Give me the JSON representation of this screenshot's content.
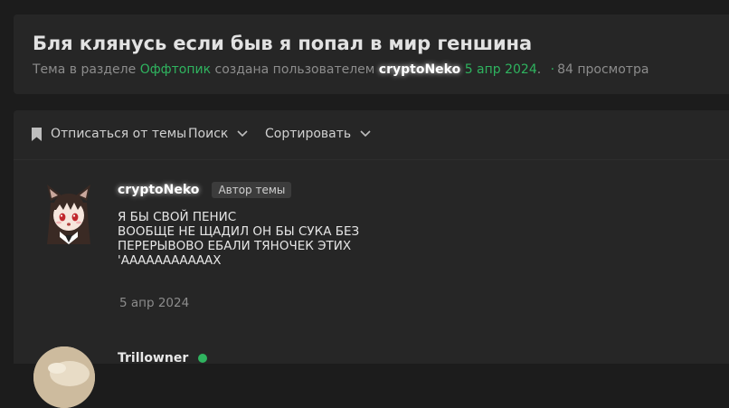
{
  "thread": {
    "title": "Бля клянусь если быв я попал в мир геншина",
    "meta_prefix": "Тема в разделе",
    "section": "Оффтопик",
    "meta_created": "создана пользователем",
    "author": "cryptoNeko",
    "date": "5 апр 2024",
    "period": ".",
    "views": "84 просмотра"
  },
  "toolbar": {
    "unsubscribe_label": "Отписаться от темы",
    "search_label": "Поиск",
    "sort_label": "Сортировать"
  },
  "posts": [
    {
      "author": "cryptoNeko",
      "badge": "Автор темы",
      "lines": [
        "Я БЫ СВОЙ ПЕНИС",
        "ВООБЩЕ НЕ ЩАДИЛ ОН БЫ СУКА БЕЗ",
        "ПЕРЕРЫВОВО ЕБАЛИ ТЯНОЧЕК ЭТИХ",
        "'АААААААААААХ"
      ],
      "date": "5 апр 2024"
    },
    {
      "author": "Trillowner"
    }
  ],
  "colors": {
    "accent_green": "#2fb35f",
    "background": "#1c1c1c",
    "panel": "#262626"
  },
  "icons": [
    "bookmark-icon",
    "chevron-down-icon",
    "online-status-icon"
  ]
}
